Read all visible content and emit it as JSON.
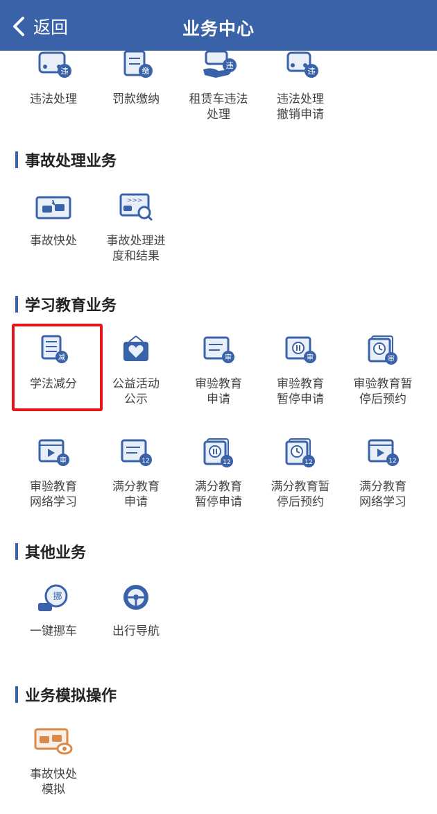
{
  "nav": {
    "back_label": "返回",
    "title": "业务中心"
  },
  "top_row": [
    {
      "label": "违法处理",
      "icon": "car-violation-icon",
      "badge": "违"
    },
    {
      "label": "罚款缴纳",
      "icon": "fine-payment-icon",
      "badge": "缴"
    },
    {
      "label": "租赁车违法处理",
      "icon": "rental-car-violation-icon",
      "badge": "违"
    },
    {
      "label": "违法处理撤销申请",
      "icon": "violation-cancel-icon",
      "badge": "违"
    }
  ],
  "sections": {
    "accident": {
      "title": "事故处理业务",
      "items": [
        {
          "label": "事故快处",
          "icon": "accident-quick-icon"
        },
        {
          "label": "事故处理进度和结果",
          "icon": "accident-progress-icon"
        }
      ]
    },
    "education": {
      "title": "学习教育业务",
      "items": [
        {
          "label": "学法减分",
          "icon": "study-deduct-icon",
          "badge": "减"
        },
        {
          "label": "公益活动公示",
          "icon": "public-welfare-icon"
        },
        {
          "label": "审验教育申请",
          "icon": "review-edu-apply-icon",
          "badge": "审"
        },
        {
          "label": "审验教育暂停申请",
          "icon": "review-edu-pause-icon",
          "badge": "审"
        },
        {
          "label": "审验教育暂停后预约",
          "icon": "review-edu-appointment-icon",
          "badge": "审"
        },
        {
          "label": "审验教育网络学习",
          "icon": "review-edu-online-icon",
          "badge": "审"
        },
        {
          "label": "满分教育申请",
          "icon": "full-score-apply-icon",
          "badge": "12"
        },
        {
          "label": "满分教育暂停申请",
          "icon": "full-score-pause-icon",
          "badge": "12"
        },
        {
          "label": "满分教育暂停后预约",
          "icon": "full-score-appointment-icon",
          "badge": "12"
        },
        {
          "label": "满分教育网络学习",
          "icon": "full-score-online-icon",
          "badge": "12"
        }
      ]
    },
    "other": {
      "title": "其他业务",
      "items": [
        {
          "label": "一键挪车",
          "icon": "move-car-icon",
          "badge": "挪"
        },
        {
          "label": "出行导航",
          "icon": "navigation-icon"
        }
      ]
    },
    "simulation": {
      "title": "业务模拟操作",
      "items": [
        {
          "label": "事故快处模拟",
          "icon": "accident-simulation-icon"
        }
      ]
    }
  },
  "colors": {
    "nav": "#3a62a8",
    "icon_blue": "#3a62a8",
    "icon_orange": "#d98a4a",
    "highlight": "#e8141c"
  }
}
